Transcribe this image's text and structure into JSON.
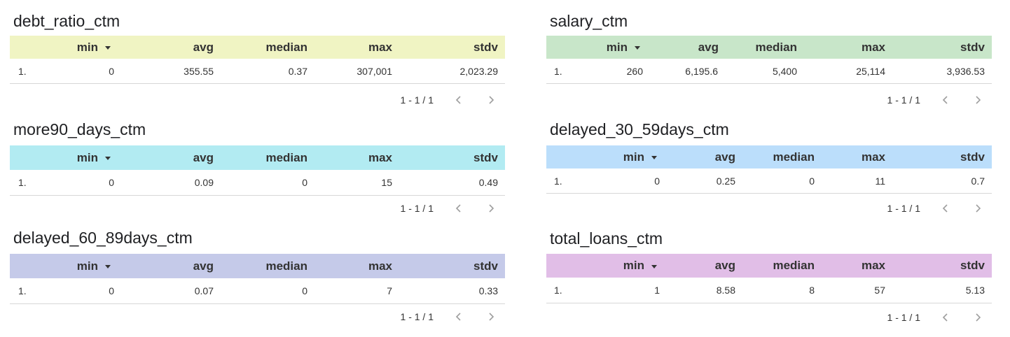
{
  "columns": {
    "min": "min",
    "avg": "avg",
    "median": "median",
    "max": "max",
    "stdv": "stdv"
  },
  "panels": [
    {
      "title": "debt_ratio_ctm",
      "header_color": "#f0f4c3",
      "row": {
        "index": "1.",
        "min": "0",
        "avg": "355.55",
        "median": "0.37",
        "max": "307,001",
        "stdv": "2,023.29"
      },
      "pagination": "1 - 1 / 1"
    },
    {
      "title": "salary_ctm",
      "header_color": "#c8e6c9",
      "row": {
        "index": "1.",
        "min": "260",
        "avg": "6,195.6",
        "median": "5,400",
        "max": "25,114",
        "stdv": "3,936.53"
      },
      "pagination": "1 - 1 / 1"
    },
    {
      "title": "more90_days_ctm",
      "header_color": "#b2ebf2",
      "row": {
        "index": "1.",
        "min": "0",
        "avg": "0.09",
        "median": "0",
        "max": "15",
        "stdv": "0.49"
      },
      "pagination": "1 - 1 / 1"
    },
    {
      "title": "delayed_30_59days_ctm",
      "header_color": "#bbdefb",
      "row": {
        "index": "1.",
        "min": "0",
        "avg": "0.25",
        "median": "0",
        "max": "11",
        "stdv": "0.7"
      },
      "pagination": "1 - 1 / 1"
    },
    {
      "title": "delayed_60_89days_ctm",
      "header_color": "#c5cae9",
      "row": {
        "index": "1.",
        "min": "0",
        "avg": "0.07",
        "median": "0",
        "max": "7",
        "stdv": "0.33"
      },
      "pagination": "1 - 1 / 1"
    },
    {
      "title": "total_loans_ctm",
      "header_color": "#e1bee7",
      "row": {
        "index": "1.",
        "min": "1",
        "avg": "8.58",
        "median": "8",
        "max": "57",
        "stdv": "5.13"
      },
      "pagination": "1 - 1 / 1"
    }
  ]
}
